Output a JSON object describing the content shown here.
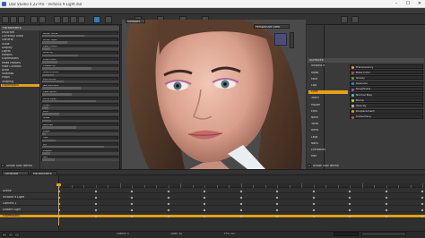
{
  "window": {
    "title": "Daz Studio 4.22 Pro - Victoria 9 Light.duf",
    "min_label": "–",
    "max_label": "☐",
    "close_label": "✕"
  },
  "viewport": {
    "tab_label": "Viewport",
    "camera_label": "Perspective View"
  },
  "left_panel": {
    "header": "Parameters",
    "categories": [
      "Favorites",
      "Currently Used",
      "General",
      "Scale",
      "Display",
      "Lights",
      "Morphs",
      "Expressions",
      "Head Morphs",
      "Pose Controls",
      "Actor",
      "Visemes",
      "Props",
      "Shaping",
      "Expressions"
    ],
    "selected_category_index": 14,
    "sliders": [
      {
        "label": "Mouth Smile",
        "fill": 0.55
      },
      {
        "label": "Mouth Open",
        "fill": 0.32
      },
      {
        "label": "Eyes Closed",
        "fill": 0.1
      },
      {
        "label": "Brow Up",
        "fill": 0.46
      },
      {
        "label": "Brow Down",
        "fill": 0.2
      },
      {
        "label": "Cheeks Up",
        "fill": 0.64
      },
      {
        "label": "Nose Wrinkle",
        "fill": 0.15
      },
      {
        "label": "Lips Pucker",
        "fill": 0.28
      },
      {
        "label": "Jaw Side-Side",
        "fill": 0.5
      },
      {
        "label": "Eyes Squint",
        "fill": 0.38
      },
      {
        "label": "Smile Open",
        "fill": 0.7
      },
      {
        "label": "Frown",
        "fill": 0.08
      },
      {
        "label": "Pout",
        "fill": 0.22
      },
      {
        "label": "Sneer",
        "fill": 0.12
      },
      {
        "label": "Surprise",
        "fill": 0.44
      },
      {
        "label": "Anger",
        "fill": 0.05
      },
      {
        "label": "Fear",
        "fill": 0.18
      },
      {
        "label": "Joy",
        "fill": 0.8
      },
      {
        "label": "Disgust",
        "fill": 0.1
      },
      {
        "label": "Sad",
        "fill": 0.16
      }
    ],
    "footer": "Show Sub Items"
  },
  "right_panel": {
    "header": "Surfaces",
    "tree": [
      "Victoria 9",
      "Head",
      "Face",
      "Lips",
      "Eyes",
      "Teeth",
      "Mouth",
      "Ears",
      "Neck",
      "Torso",
      "Arms",
      "Legs",
      "Nails",
      "Eyelashes",
      "Hair"
    ],
    "selected_tree_index": 4,
    "properties": [
      {
        "label": "Translucency",
        "color": "#d4a12a"
      },
      {
        "label": "Base Color",
        "color": "#c64a4a"
      },
      {
        "label": "Glossy",
        "color": "#4aa64a"
      },
      {
        "label": "Specular",
        "color": "#4a7ac6"
      },
      {
        "label": "Roughness",
        "color": "#a64ac6"
      },
      {
        "label": "Normal Map",
        "color": "#4ac6c6"
      },
      {
        "label": "Bump",
        "color": "#c6c64a"
      },
      {
        "label": "Opacity",
        "color": "#bbbbbb"
      },
      {
        "label": "Displacement",
        "color": "#d4a12a"
      },
      {
        "label": "Subsurface",
        "color": "#c64a4a"
      }
    ],
    "footer": "Show Sub Items"
  },
  "timeline": {
    "tabs": [
      "Timeline",
      "Parameters"
    ],
    "tracks": [
      "Scene",
      "Victoria 9 Light",
      "Camera 1",
      "Distant Light",
      "Expressions"
    ],
    "selected_track_index": 4,
    "status": [
      "Frame 0",
      "Total 30",
      "FPS 30"
    ]
  },
  "colors": {
    "accent": "#e3a117",
    "toolbar_accent": "#2e7fb7"
  }
}
